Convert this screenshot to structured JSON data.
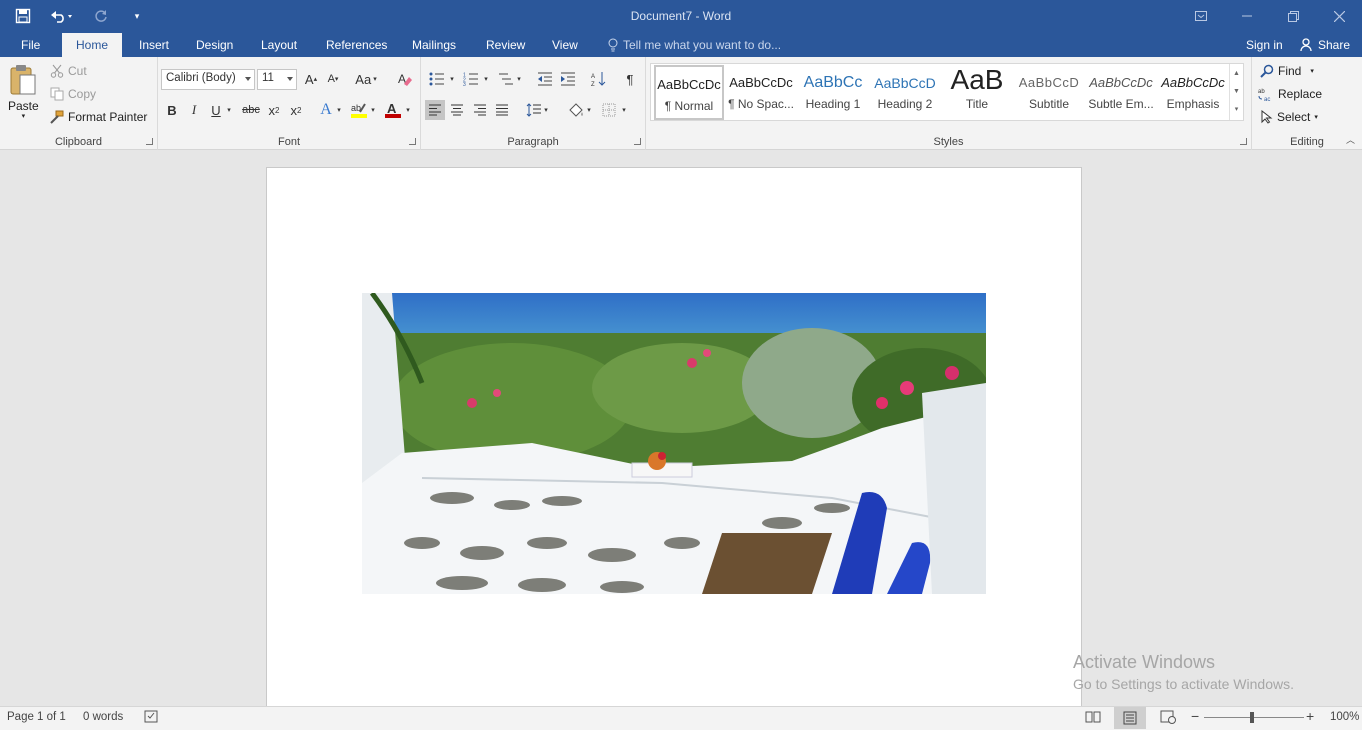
{
  "window": {
    "title": "Document7 - Word",
    "sign_in": "Sign in",
    "share": "Share",
    "tell_me": "Tell me what you want to do..."
  },
  "tabs": [
    "File",
    "Home",
    "Insert",
    "Design",
    "Layout",
    "References",
    "Mailings",
    "Review",
    "View"
  ],
  "clipboard": {
    "group": "Clipboard",
    "paste": "Paste",
    "cut": "Cut",
    "copy": "Copy",
    "format_painter": "Format Painter"
  },
  "font": {
    "group": "Font",
    "name": "Calibri (Body)",
    "size": "11"
  },
  "paragraph": {
    "group": "Paragraph"
  },
  "styles": {
    "group": "Styles",
    "items": [
      {
        "preview": "AaBbCcDc",
        "name": "¶ Normal"
      },
      {
        "preview": "AaBbCcDc",
        "name": "¶ No Spac..."
      },
      {
        "preview": "AaBbCc",
        "name": "Heading 1"
      },
      {
        "preview": "AaBbCcD",
        "name": "Heading 2"
      },
      {
        "preview": "AaB",
        "name": "Title"
      },
      {
        "preview": "AaBbCcD",
        "name": "Subtitle"
      },
      {
        "preview": "AaBbCcDc",
        "name": "Subtle Em..."
      },
      {
        "preview": "AaBbCcDc",
        "name": "Emphasis"
      }
    ]
  },
  "editing": {
    "group": "Editing",
    "find": "Find",
    "replace": "Replace",
    "select": "Select"
  },
  "watermark": {
    "line1": "Activate Windows",
    "line2": "Go to Settings to activate Windows."
  },
  "status": {
    "page": "Page 1 of 1",
    "words": "0 words",
    "zoom": "100%"
  },
  "colors": {
    "brand": "#2b579a",
    "ribbon": "#f3f3f3"
  }
}
